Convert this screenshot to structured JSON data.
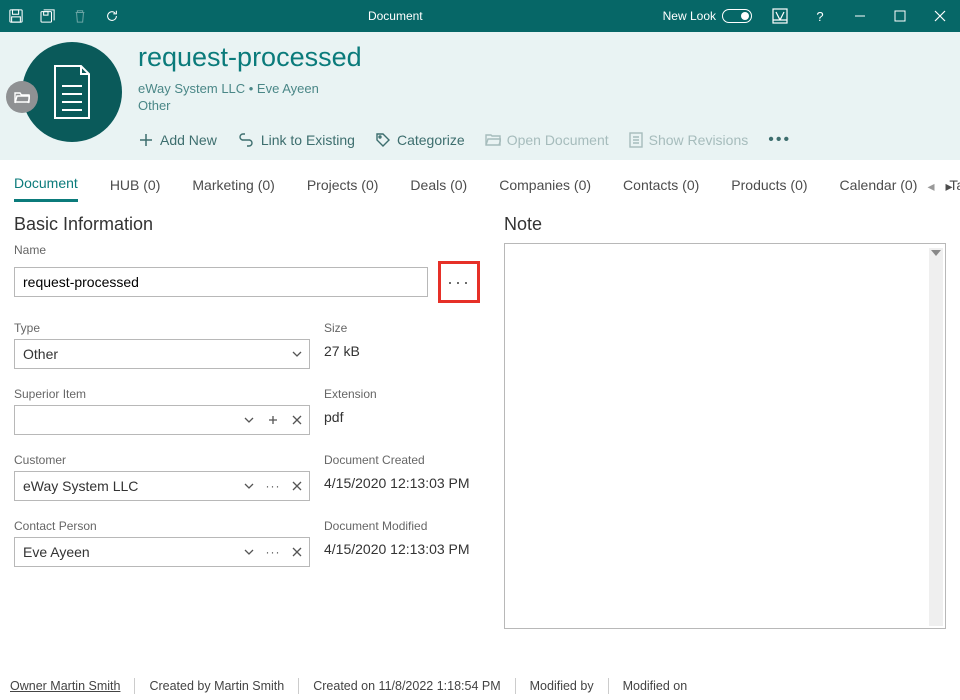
{
  "window_title": "Document",
  "newlook_label": "New Look",
  "header": {
    "title": "request-processed",
    "breadcrumb": "eWay System LLC • Eve Ayeen",
    "subtitle": "Other",
    "actions": {
      "add_new": "Add New",
      "link_existing": "Link to Existing",
      "categorize": "Categorize",
      "open_document": "Open Document",
      "show_revisions": "Show Revisions"
    }
  },
  "tabs": [
    {
      "label": "Document",
      "active": true
    },
    {
      "label": "HUB (0)"
    },
    {
      "label": "Marketing (0)"
    },
    {
      "label": "Projects (0)"
    },
    {
      "label": "Deals (0)"
    },
    {
      "label": "Companies (0)"
    },
    {
      "label": "Contacts (0)"
    },
    {
      "label": "Products (0)"
    },
    {
      "label": "Calendar (0)"
    },
    {
      "label": "Tas"
    }
  ],
  "sections": {
    "basic_info": "Basic Information",
    "note": "Note"
  },
  "fields": {
    "name_label": "Name",
    "name_value": "request-processed",
    "type_label": "Type",
    "type_value": "Other",
    "size_label": "Size",
    "size_value": "27 kB",
    "superior_label": "Superior Item",
    "superior_value": "",
    "extension_label": "Extension",
    "extension_value": "pdf",
    "customer_label": "Customer",
    "customer_value": "eWay System LLC",
    "created_label": "Document Created",
    "created_value": "4/15/2020 12:13:03 PM",
    "contact_label": "Contact Person",
    "contact_value": "Eve Ayeen",
    "modified_label": "Document Modified",
    "modified_value": "4/15/2020 12:13:03 PM"
  },
  "status": {
    "owner": "Owner Martin Smith",
    "created_by": "Created by Martin Smith",
    "created_on": "Created on 11/8/2022 1:18:54 PM",
    "modified_by": "Modified by",
    "modified_on": "Modified on"
  }
}
